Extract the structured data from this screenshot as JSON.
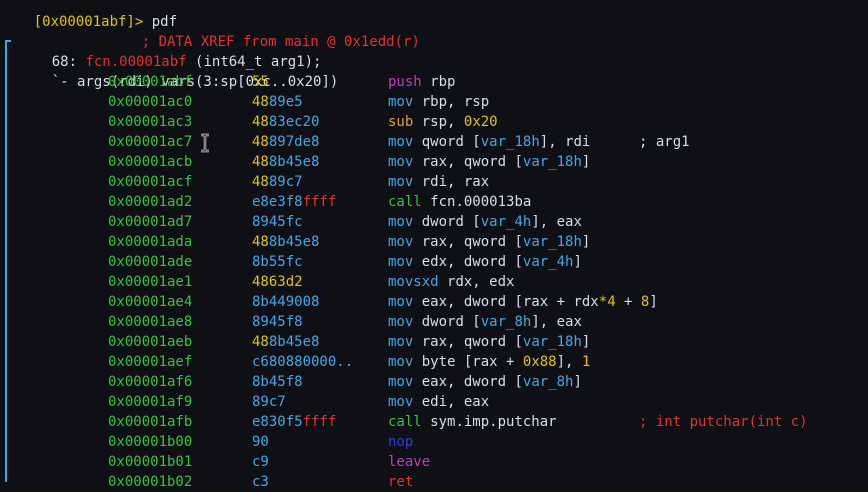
{
  "prompt": {
    "text": "[0x00001abf]>",
    "command": " pdf"
  },
  "xref": "; DATA XREF from main @ 0x1edd(r)",
  "header": {
    "size": "68:",
    "fname": "fcn.00001abf",
    "sig": " (int64_t arg1);"
  },
  "args_line": "`- args(rdi) vars(3:sp[0xc..0x20])",
  "rows": [
    {
      "addr": "0x00001abf",
      "b1": "55",
      "b2": "",
      "b1c": "b-yel",
      "b2c": "",
      "m": "push",
      "mc": "mn-push",
      "ops": [
        [
          "rbp",
          "op"
        ]
      ]
    },
    {
      "addr": "0x00001ac0",
      "b1": "48",
      "b2": "89e5",
      "b1c": "b-yel",
      "b2c": "b-norm",
      "m": "mov",
      "mc": "mn-mov",
      "ops": [
        [
          "rbp, rsp",
          "op"
        ]
      ]
    },
    {
      "addr": "0x00001ac3",
      "b1": "48",
      "b2": "83ec20",
      "b1c": "b-yel",
      "b2c": "b-norm",
      "m": "sub",
      "mc": "mn-arith",
      "ops": [
        [
          "rsp, ",
          "op"
        ],
        [
          "0x20",
          "num"
        ]
      ]
    },
    {
      "addr": "0x00001ac7",
      "b1": "48",
      "b2": "897de8",
      "b1c": "b-yel",
      "b2c": "b-norm",
      "m": "mov",
      "mc": "mn-mov",
      "ops": [
        [
          "qword [",
          "op"
        ],
        [
          "var_18h",
          "sym"
        ],
        [
          "], rdi",
          "op"
        ]
      ],
      "comment": "; arg1",
      "cc": "comment"
    },
    {
      "addr": "0x00001acb",
      "b1": "48",
      "b2": "8b45e8",
      "b1c": "b-yel",
      "b2c": "b-norm",
      "m": "mov",
      "mc": "mn-mov",
      "ops": [
        [
          "rax, qword [",
          "op"
        ],
        [
          "var_18h",
          "sym"
        ],
        [
          "]",
          "op"
        ]
      ]
    },
    {
      "addr": "0x00001acf",
      "b1": "48",
      "b2": "89c7",
      "b1c": "b-yel",
      "b2c": "b-norm",
      "m": "mov",
      "mc": "mn-mov",
      "ops": [
        [
          "rdi, rax",
          "op"
        ]
      ]
    },
    {
      "addr": "0x00001ad2",
      "b1": "e8e3f8",
      "b2": "ffff",
      "b1c": "b-norm",
      "b2c": "b-red",
      "m": "call",
      "mc": "mn-call",
      "ops": [
        [
          "fcn.000013ba",
          "op"
        ]
      ]
    },
    {
      "addr": "0x00001ad7",
      "b1": "8945fc",
      "b2": "",
      "b1c": "b-norm",
      "b2c": "",
      "m": "mov",
      "mc": "mn-mov",
      "ops": [
        [
          "dword [",
          "op"
        ],
        [
          "var_4h",
          "sym"
        ],
        [
          "], eax",
          "op"
        ]
      ]
    },
    {
      "addr": "0x00001ada",
      "b1": "48",
      "b2": "8b45e8",
      "b1c": "b-yel",
      "b2c": "b-norm",
      "m": "mov",
      "mc": "mn-mov",
      "ops": [
        [
          "rax, qword [",
          "op"
        ],
        [
          "var_18h",
          "sym"
        ],
        [
          "]",
          "op"
        ]
      ]
    },
    {
      "addr": "0x00001ade",
      "b1": "8b55fc",
      "b2": "",
      "b1c": "b-norm",
      "b2c": "",
      "m": "mov",
      "mc": "mn-mov",
      "ops": [
        [
          "edx, dword [",
          "op"
        ],
        [
          "var_4h",
          "sym"
        ],
        [
          "]",
          "op"
        ]
      ]
    },
    {
      "addr": "0x00001ae1",
      "b1": "4863d2",
      "b2": "",
      "b1c": "b-yel",
      "b2c": "",
      "m": "movsxd",
      "mc": "mn-mov",
      "ops": [
        [
          "rdx, edx",
          "op"
        ]
      ]
    },
    {
      "addr": "0x00001ae4",
      "b1": "8b449008",
      "b2": "",
      "b1c": "b-norm",
      "b2c": "",
      "m": "mov",
      "mc": "mn-mov",
      "ops": [
        [
          "eax, dword [rax + rdx",
          "op"
        ],
        [
          "*",
          "num"
        ],
        [
          "4",
          "num"
        ],
        [
          " + ",
          "op"
        ],
        [
          "8",
          "num"
        ],
        [
          "]",
          "op"
        ]
      ]
    },
    {
      "addr": "0x00001ae8",
      "b1": "8945f8",
      "b2": "",
      "b1c": "b-norm",
      "b2c": "",
      "m": "mov",
      "mc": "mn-mov",
      "ops": [
        [
          "dword [",
          "op"
        ],
        [
          "var_8h",
          "sym"
        ],
        [
          "], eax",
          "op"
        ]
      ]
    },
    {
      "addr": "0x00001aeb",
      "b1": "48",
      "b2": "8b45e8",
      "b1c": "b-yel",
      "b2c": "b-norm",
      "m": "mov",
      "mc": "mn-mov",
      "ops": [
        [
          "rax, qword [",
          "op"
        ],
        [
          "var_18h",
          "sym"
        ],
        [
          "]",
          "op"
        ]
      ]
    },
    {
      "addr": "0x00001aef",
      "b1": "c680880000..",
      "b2": "",
      "b1c": "b-norm",
      "b2c": "",
      "m": "mov",
      "mc": "mn-mov",
      "ops": [
        [
          "byte [rax + ",
          "op"
        ],
        [
          "0x88",
          "num"
        ],
        [
          "], ",
          "op"
        ],
        [
          "1",
          "num"
        ]
      ]
    },
    {
      "addr": "0x00001af6",
      "b1": "8b45f8",
      "b2": "",
      "b1c": "b-norm",
      "b2c": "",
      "m": "mov",
      "mc": "mn-mov",
      "ops": [
        [
          "eax, dword [",
          "op"
        ],
        [
          "var_8h",
          "sym"
        ],
        [
          "]",
          "op"
        ]
      ]
    },
    {
      "addr": "0x00001af9",
      "b1": "89c7",
      "b2": "",
      "b1c": "b-norm",
      "b2c": "",
      "m": "mov",
      "mc": "mn-mov",
      "ops": [
        [
          "edi, eax",
          "op"
        ]
      ]
    },
    {
      "addr": "0x00001afb",
      "b1": "e830f5",
      "b2": "ffff",
      "b1c": "b-norm",
      "b2c": "b-red",
      "m": "call",
      "mc": "mn-call",
      "ops": [
        [
          "sym.imp.putchar",
          "op"
        ]
      ],
      "comment": "; int putchar(int c)",
      "cc": "comment-red"
    },
    {
      "addr": "0x00001b00",
      "b1": "90",
      "b2": "",
      "b1c": "b-norm",
      "b2c": "",
      "m": "nop",
      "mc": "mn-nop",
      "ops": []
    },
    {
      "addr": "0x00001b01",
      "b1": "c9",
      "b2": "",
      "b1c": "b-norm",
      "b2c": "",
      "m": "leave",
      "mc": "mn-push",
      "ops": []
    },
    {
      "addr": "0x00001b02",
      "b1": "c3",
      "b2": "",
      "b1c": "b-norm",
      "b2c": "",
      "m": "ret",
      "mc": "mn-ret",
      "ops": []
    }
  ]
}
